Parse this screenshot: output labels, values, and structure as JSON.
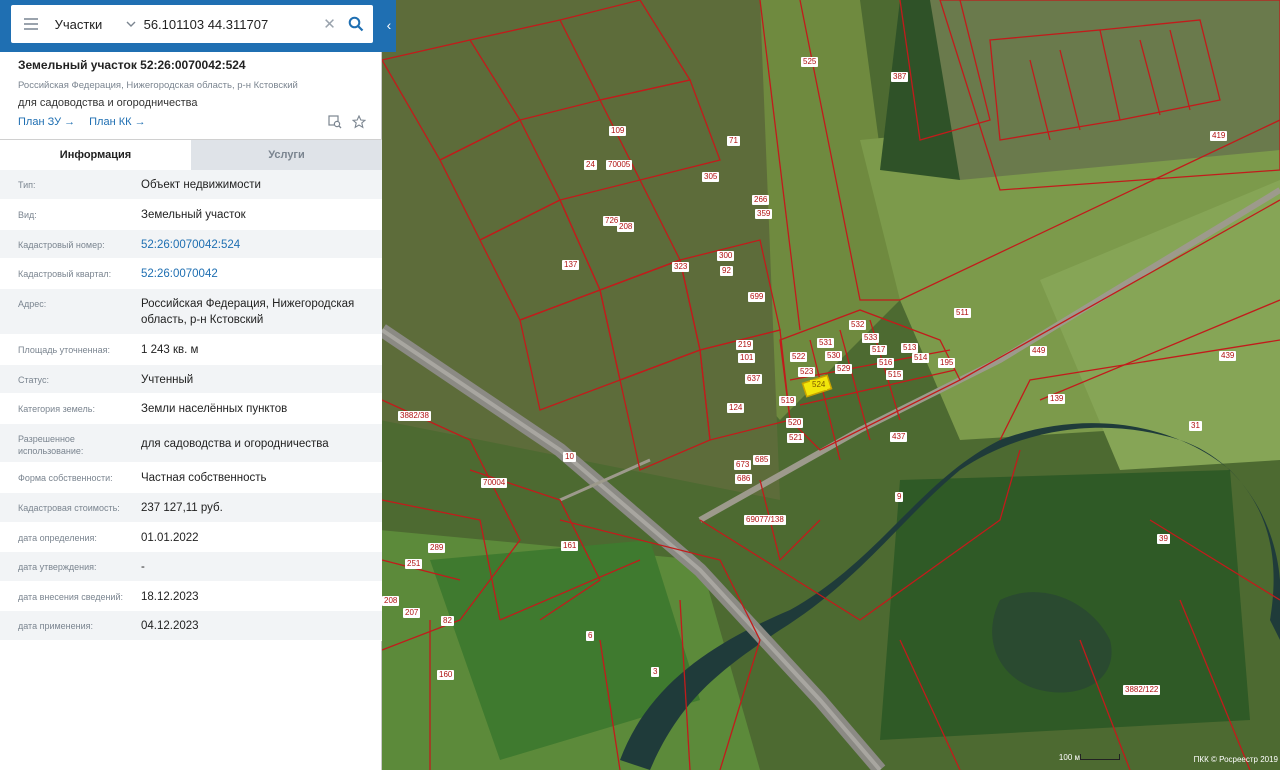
{
  "search": {
    "type_label": "Участки",
    "query": "56.101103 44.311707"
  },
  "object": {
    "title": "Земельный участок 52:26:0070042:524",
    "address_short": "Российская Федерация, Нижегородская область, р-н Кстовский",
    "use": "для садоводства и огородничества",
    "plan_zu": "План ЗУ →",
    "plan_kk": "План КК →"
  },
  "tabs": [
    {
      "label": "Информация"
    },
    {
      "label": "Услуги"
    }
  ],
  "properties": [
    {
      "key": "Тип:",
      "value": "Объект недвижимости"
    },
    {
      "key": "Вид:",
      "value": "Земельный участок"
    },
    {
      "key": "Кадастровый номер:",
      "value": "52:26:0070042:524"
    },
    {
      "key": "Кадастровый квартал:",
      "value": "52:26:0070042"
    },
    {
      "key": "Адрес:",
      "value": "Российская Федерация, Нижегородская область, р-н Кстовский"
    },
    {
      "key": "Площадь уточненная:",
      "value": "1 243 кв. м"
    },
    {
      "key": "Статус:",
      "value": "Учтенный"
    },
    {
      "key": "Категория земель:",
      "value": "Земли населённых пунктов"
    },
    {
      "key": "Разрешенное использование:",
      "value": "для садоводства и огородничества"
    },
    {
      "key": "Форма собственности:",
      "value": "Частная собственность"
    },
    {
      "key": "Кадастровая стоимость:",
      "value": "237 127,11 руб."
    },
    {
      "key": "дата определения:",
      "value": "01.01.2022"
    },
    {
      "key": "дата утверждения:",
      "value": "-"
    },
    {
      "key": "дата внесения сведений:",
      "value": "18.12.2023"
    },
    {
      "key": "дата применения:",
      "value": "04.12.2023"
    }
  ],
  "map": {
    "parcel_labels": [
      "525",
      "387",
      "419",
      "511",
      "439",
      "437",
      "139",
      "31",
      "39",
      "3882/38",
      "3882/122",
      "160",
      "82",
      "6",
      "3",
      "10",
      "161",
      "124",
      "637",
      "699",
      "300",
      "92",
      "266",
      "359",
      "305",
      "71",
      "109",
      "24",
      "70005",
      "70004",
      "726",
      "208",
      "137",
      "323",
      "219",
      "101",
      "532",
      "533",
      "531",
      "530",
      "529",
      "522",
      "523",
      "517",
      "516",
      "515",
      "514",
      "513",
      "195",
      "449",
      "519",
      "520",
      "521",
      "673",
      "686",
      "685",
      "69077/138",
      "9",
      "207",
      "208",
      "251",
      "289"
    ],
    "selected_label": "524",
    "scale_label": "100 м",
    "copyright": "ПКК © Росреестр 2019"
  }
}
